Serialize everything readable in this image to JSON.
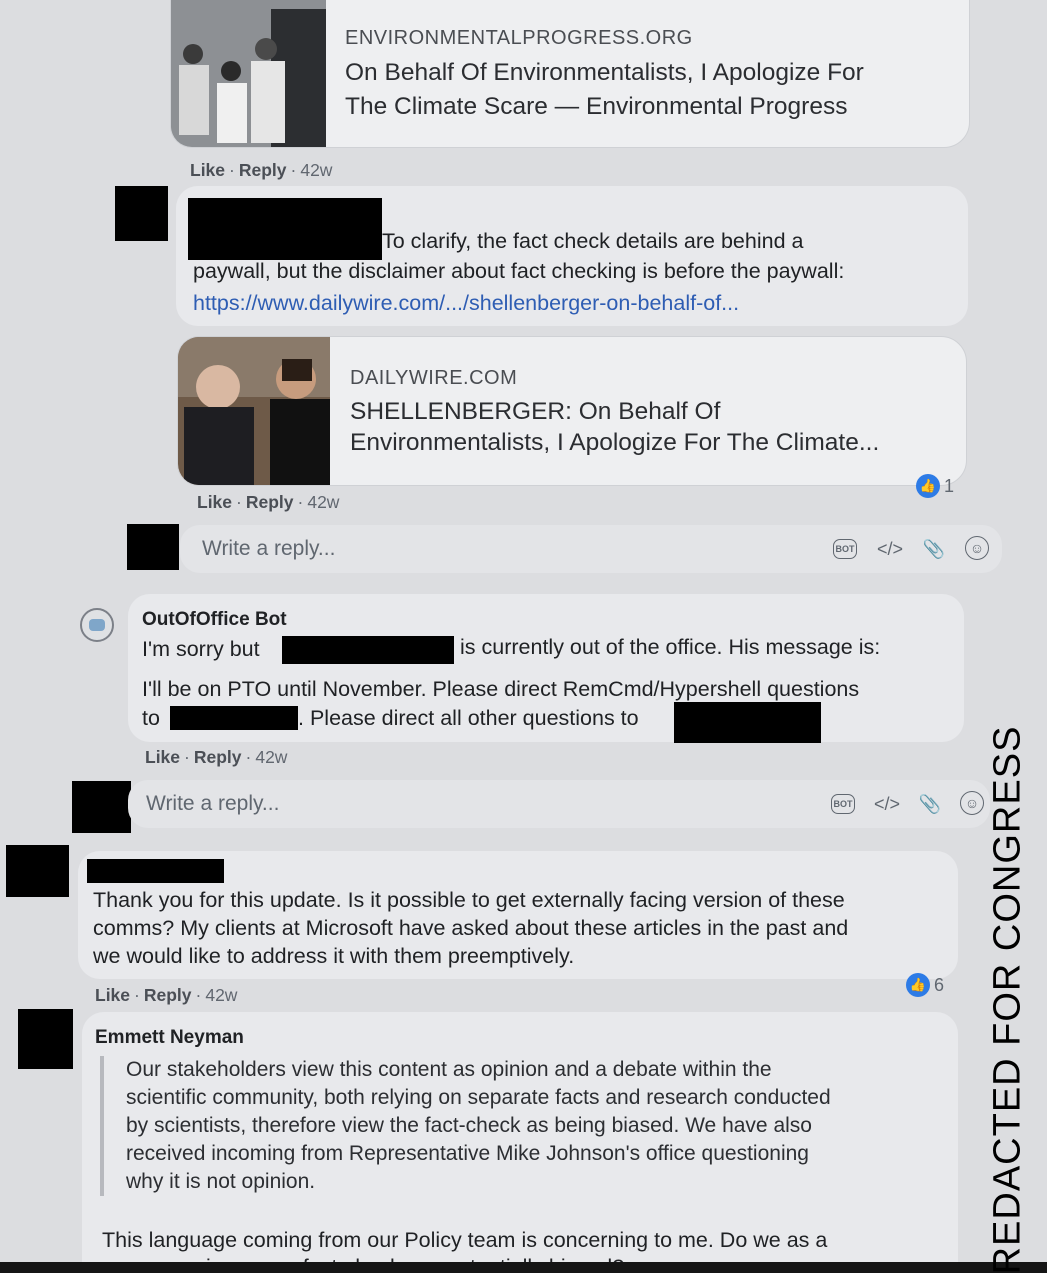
{
  "thread": {
    "card1": {
      "domain": "ENVIRONMENTALPROGRESS.ORG",
      "title_line1": "On Behalf Of Environmentalists, I Apologize For",
      "title_line2": "The Climate Scare — Environmental Progress",
      "image_icon": "photo-thumbnail"
    },
    "meta1": {
      "like": "Like",
      "reply": "Reply",
      "time": "42w"
    },
    "comment2": {
      "line1": "To clarify, the fact check details are behind a",
      "line2": "paywall, but the disclaimer about fact checking is before the paywall:",
      "link": "https://www.dailywire.com/.../shellenberger-on-behalf-of..."
    },
    "card2": {
      "domain": "DAILYWIRE.COM",
      "title_line1": "SHELLENBERGER: On Behalf Of",
      "title_line2": "Environmentalists, I Apologize For The Climate...",
      "reaction_count": "1"
    },
    "meta2": {
      "like": "Like",
      "reply": "Reply",
      "time": "42w"
    },
    "reply_box1": {
      "placeholder": "Write a reply...",
      "bot_label": "BOT",
      "code_label": "</>"
    },
    "bot_comment": {
      "author": "OutOfOffice Bot",
      "line1a": "I'm sorry but",
      "line1b": "is currently out of the office. His message is:",
      "line2": "I'll be on PTO until November. Please direct RemCmd/Hypershell questions",
      "line3a": "to",
      "line3b": ". Please direct all other questions to"
    },
    "meta3": {
      "like": "Like",
      "reply": "Reply",
      "time": "42w"
    },
    "reply_box2": {
      "placeholder": "Write a reply...",
      "bot_label": "BOT",
      "code_label": "</>"
    },
    "comment4": {
      "line1": "Thank you for this update. Is it possible to get externally facing version of these",
      "line2": "comms? My clients at Microsoft have asked about these articles in the past and",
      "line3": "we would like to address it with them preemptively.",
      "reaction_count": "6"
    },
    "meta4": {
      "like": "Like",
      "reply": "Reply",
      "time": "42w"
    },
    "comment5": {
      "author": "Emmett Neyman",
      "quote_line1": "Our stakeholders view this content as opinion and a debate within the",
      "quote_line2": "scientific community, both relying on separate facts and research conducted",
      "quote_line3": "by scientists, therefore view the fact-check as being biased. We have also",
      "quote_line4": "received incoming from Representative Mike Johnson's office questioning",
      "quote_line5": "why it is not opinion.",
      "body_line1": "This language coming from our Policy team is concerning to me. Do we as a",
      "body_line2": "company view some fact-checks as potentially biased?"
    }
  },
  "overlay": {
    "side_label": "REDACTED FOR CONGRESS"
  },
  "colors": {
    "link": "#2e5db3",
    "like_blue": "#2d7be6",
    "redaction": "#000000"
  }
}
